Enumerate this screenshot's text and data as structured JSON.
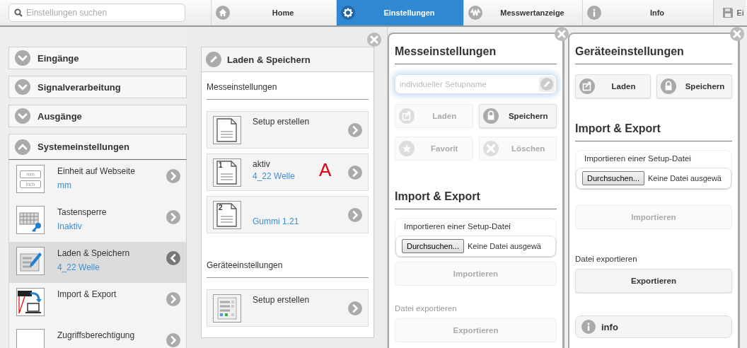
{
  "search": {
    "placeholder": "Einstellungen suchen"
  },
  "nav": [
    {
      "kind": "home",
      "label": "Home",
      "selected": false
    },
    {
      "kind": "gear",
      "label": "Einstellungen",
      "selected": true
    },
    {
      "kind": "wave",
      "label": "Messwertanzeige",
      "selected": false
    },
    {
      "kind": "info",
      "label": "Info",
      "selected": false
    },
    {
      "kind": "disk",
      "label": "Ei",
      "selected": false
    }
  ],
  "sidebar": {
    "sections": [
      {
        "label": "Eingänge",
        "expanded": false
      },
      {
        "label": "Signalverarbeitung",
        "expanded": false
      },
      {
        "label": "Ausgänge",
        "expanded": false
      },
      {
        "label": "Systemeinstellungen",
        "expanded": true,
        "items": [
          {
            "kind": "units",
            "icon_labels": [
              "mm",
              "inch"
            ],
            "title": "Einheit auf Webseite",
            "value": "mm",
            "selected": false
          },
          {
            "kind": "keylock",
            "title": "Tastensperre",
            "value": "Inaktiv",
            "selected": false
          },
          {
            "kind": "edit",
            "title": "Laden & Speichern",
            "value": "4_22 Welle",
            "selected": true
          },
          {
            "kind": "transfer",
            "title": "Import & Export",
            "selected": false
          },
          {
            "kind": "blank",
            "title": "Zugriffsberechtigung",
            "selected": false
          }
        ]
      }
    ]
  },
  "load_save": {
    "title": "Laden & Speichern",
    "groups": [
      {
        "heading": "Messeinstellungen",
        "entries": [
          {
            "kind": "doc",
            "title": "Setup erstellen"
          },
          {
            "kind": "doc",
            "number": "1",
            "title": "aktiv",
            "value": "4_22 Welle",
            "annotation": "A"
          },
          {
            "kind": "doc",
            "number": "2",
            "value": "Gummi 1.21"
          }
        ]
      },
      {
        "heading": "Geräteeinstellungen",
        "entries": [
          {
            "kind": "device",
            "title": "Setup erstellen"
          }
        ]
      }
    ]
  },
  "dialogs": [
    {
      "title": "Messeinstellungen",
      "name_field": {
        "placeholder": "individueller Setupname"
      },
      "buttons": [
        {
          "kind": "load",
          "label": "Laden",
          "disabled": true
        },
        {
          "kind": "lock",
          "label": "Speichern",
          "disabled": false
        },
        {
          "kind": "star",
          "label": "Favorit",
          "disabled": true
        },
        {
          "kind": "cross",
          "label": "Löschen",
          "disabled": true
        }
      ],
      "import_export": {
        "title": "Import & Export",
        "import_label": "Importieren einer Setup-Datei",
        "browse": "Durchsuchen...",
        "file_status": "Keine Datei ausgewä",
        "import_button": "Importieren",
        "import_disabled": true,
        "export_label": "Datei exportieren",
        "export_button": "Exportieren",
        "export_disabled": true
      }
    },
    {
      "title": "Geräteeinstellungen",
      "buttons": [
        {
          "kind": "load",
          "label": "Laden",
          "disabled": false
        },
        {
          "kind": "lock",
          "label": "Speichern",
          "disabled": false
        }
      ],
      "import_export": {
        "title": "Import & Export",
        "import_label": "Importieren einer Setup-Datei",
        "browse": "Durchsuchen...",
        "file_status": "Keine Datei ausgewä",
        "import_button": "Importieren",
        "import_disabled": true,
        "export_label": "Datei exportieren",
        "export_button": "Exportieren",
        "export_disabled": false
      },
      "info_button": "info"
    }
  ]
}
